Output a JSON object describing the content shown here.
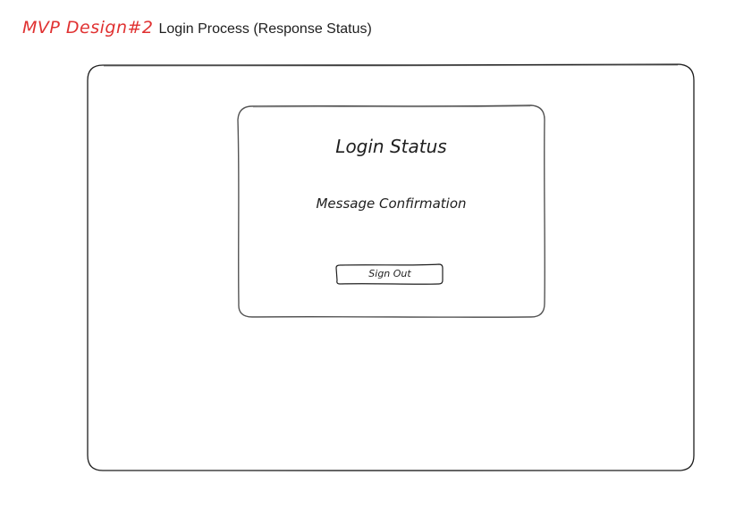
{
  "header": {
    "tag": "MVP Design#2",
    "title": "Login Process (Response Status)"
  },
  "card": {
    "title": "Login Status",
    "message": "Message Confirmation",
    "signout_label": "Sign Out"
  },
  "colors": {
    "accent": "#e03131",
    "stroke": "#1e1e1e",
    "background": "#ffffff"
  }
}
